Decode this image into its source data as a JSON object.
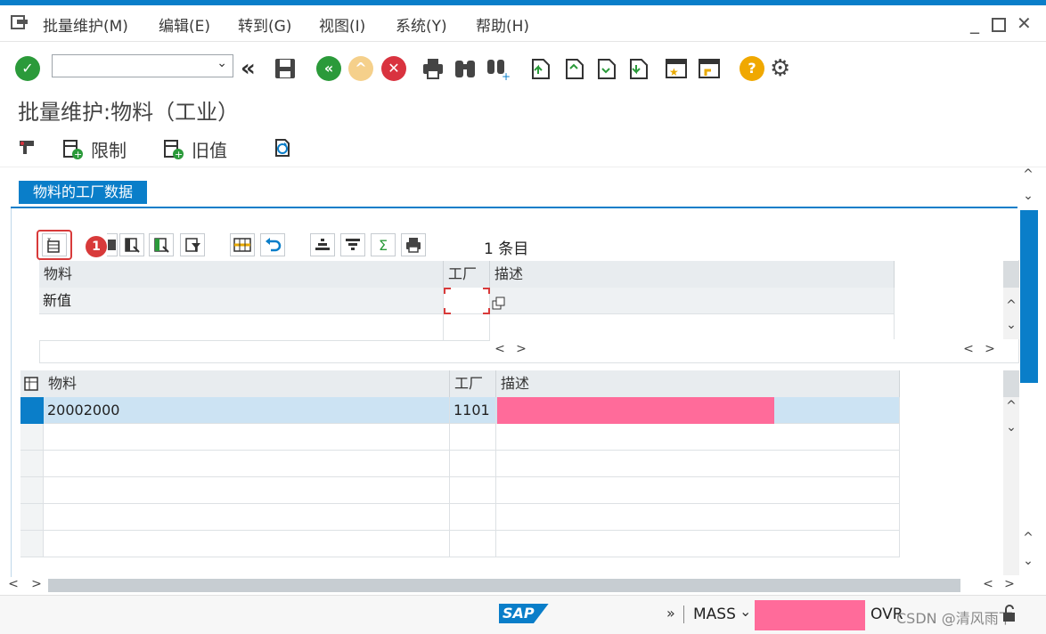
{
  "menu": {
    "items": [
      "批量维护(M)",
      "编辑(E)",
      "转到(G)",
      "视图(I)",
      "系统(Y)",
      "帮助(H)"
    ]
  },
  "title": "批量维护:物料（工业）",
  "app_toolbar": {
    "restrict_label": "限制",
    "old_value_label": "旧值"
  },
  "tab": {
    "label": "物料的工厂数据"
  },
  "grid_toolbar": {
    "count_text": "1 条目",
    "callout_badge": "1",
    "sum_glyph": "Σ"
  },
  "new_value_table": {
    "headers": {
      "material": "物料",
      "plant": "工厂",
      "description": "描述"
    },
    "row_label": "新值"
  },
  "data_table": {
    "headers": {
      "material": "物料",
      "plant": "工厂",
      "description": "描述"
    },
    "rows": [
      {
        "material": "20002000",
        "plant": "1101",
        "description_redacted": true
      }
    ],
    "empty_rows": 6
  },
  "status": {
    "transaction": "MASS",
    "overwrite": "OVR",
    "brand": "SAP",
    "watermark": "CSDN @清风雨下",
    "chevrons": "»"
  },
  "colors": {
    "accent": "#0a7ec9",
    "selected_row": "#cce3f3",
    "redaction": "#ff6b9a",
    "callout": "#d83a3a"
  }
}
